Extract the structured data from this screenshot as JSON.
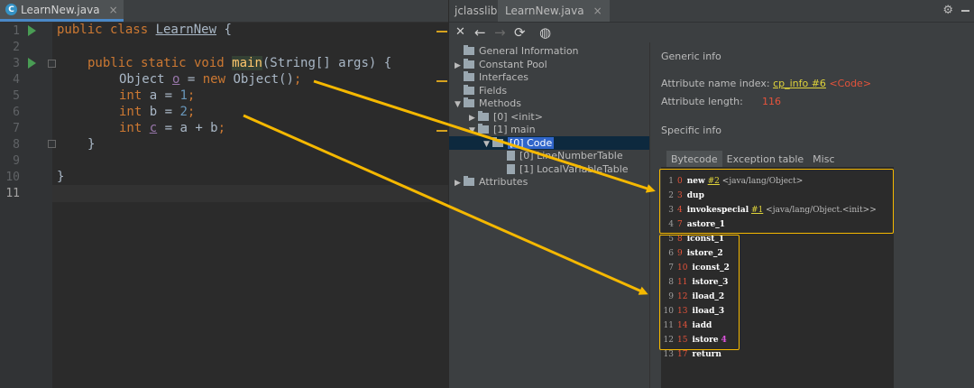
{
  "editor": {
    "tab_label": "LearnNew.java",
    "tab_close": "×",
    "lines": [
      {
        "n": "1"
      },
      {
        "n": "2"
      },
      {
        "n": "3"
      },
      {
        "n": "4"
      },
      {
        "n": "5"
      },
      {
        "n": "6"
      },
      {
        "n": "7"
      },
      {
        "n": "8"
      },
      {
        "n": "9"
      },
      {
        "n": "10"
      },
      {
        "n": "11"
      }
    ],
    "code": {
      "l1_kw": "public class ",
      "l1_name": "LearnNew",
      "l1_rest": " {",
      "l3_kw": "public static void ",
      "l3_fn": "main",
      "l3_rest": "(String[] args) {",
      "l4_a": "Object ",
      "l4_var": "o",
      "l4_b": " = ",
      "l4_kw": "new",
      "l4_c": " Object()",
      "l4_semi": ";",
      "l5_kw": "int",
      "l5_rest": " a = ",
      "l5_num": "1",
      "l5_semi": ";",
      "l6_kw": "int",
      "l6_rest": " b = ",
      "l6_num": "2",
      "l6_semi": ";",
      "l7_kw": "int",
      "l7_sp": " ",
      "l7_var": "c",
      "l7_rest": " = a + b",
      "l7_semi": ";",
      "l8": "}",
      "l10": "}"
    }
  },
  "panel": {
    "name": "jclasslib:",
    "tab_label": "LearnNew.java",
    "tab_close": "×",
    "gear": "⚙",
    "toolbar": {
      "close": "✕",
      "back": "←",
      "forward": "→",
      "refresh": "⟳",
      "web": "◍"
    },
    "tree": {
      "general": "General Information",
      "constant_pool": "Constant Pool",
      "interfaces": "Interfaces",
      "fields": "Fields",
      "methods": "Methods",
      "init": "[0] <init>",
      "main": "[1] main",
      "code": "[0] Code",
      "lnt": "[0] LineNumberTable",
      "lvt": "[1] LocalVariableTable",
      "attributes": "Attributes"
    },
    "detail": {
      "generic_info": "Generic info",
      "name_index_label": "Attribute name index:",
      "name_index_link": "cp_info #6",
      "name_index_value": "<Code>",
      "length_label": "Attribute length:",
      "length_value": "116",
      "specific_info": "Specific info",
      "tabs": [
        "Bytecode",
        "Exception table",
        "Misc"
      ]
    },
    "bytecode": [
      {
        "ln": "1",
        "off": "0",
        "op": "new",
        "ref": "#2",
        "cmt": " <java/lang/Object>"
      },
      {
        "ln": "2",
        "off": "3",
        "op": "dup"
      },
      {
        "ln": "3",
        "off": "4",
        "op": "invokespecial",
        "ref": "#1",
        "cmt": " <java/lang/Object.<init>>"
      },
      {
        "ln": "4",
        "off": "7",
        "op": "astore_1"
      },
      {
        "ln": "5",
        "off": "8",
        "op": "iconst_1"
      },
      {
        "ln": "6",
        "off": "9",
        "op": "istore_2"
      },
      {
        "ln": "7",
        "off": "10",
        "op": "iconst_2"
      },
      {
        "ln": "8",
        "off": "11",
        "op": "istore_3"
      },
      {
        "ln": "9",
        "off": "12",
        "op": "iload_2"
      },
      {
        "ln": "10",
        "off": "13",
        "op": "iload_3"
      },
      {
        "ln": "11",
        "off": "14",
        "op": "iadd"
      },
      {
        "ln": "12",
        "off": "15",
        "op": "istore",
        "mag": "4"
      },
      {
        "ln": "13",
        "off": "17",
        "op": "return"
      }
    ]
  },
  "colors": {
    "highlight": "#f5b800",
    "arrow": "#f5b800"
  }
}
